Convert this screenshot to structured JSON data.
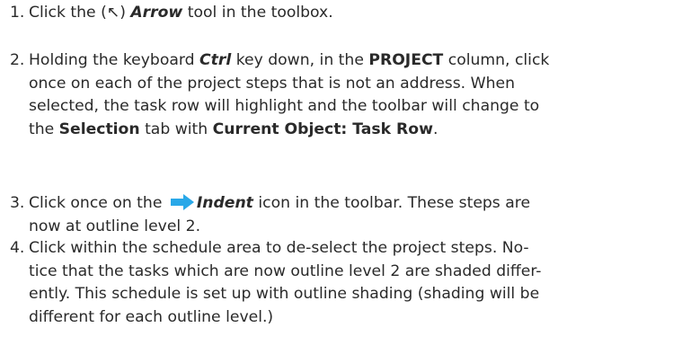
{
  "steps": [
    {
      "number": "1.",
      "lines": [
        [
          "Click  the (",
          "↖",
          ") ",
          "Arrow",
          " tool in the toolbox."
        ]
      ]
    },
    {
      "number": "2.",
      "lines": [
        [
          "Holding the keyboard ",
          "Ctrl",
          " key down, in the ",
          "PROJECT",
          " column, click"
        ],
        [
          "once on each of the project steps that is not an address.  When"
        ],
        [
          "selected, the task row will highlight and the toolbar will change to"
        ],
        [
          "the ",
          "Selection",
          " tab with ",
          "Current Object: Task Row",
          "."
        ]
      ]
    },
    {
      "number": "3.",
      "lines": [
        [
          "Click once on the ",
          "Indent",
          " icon in the toolbar. These steps are"
        ],
        [
          "now at outline level 2."
        ]
      ]
    },
    {
      "number": "4.",
      "lines": [
        [
          "Click within the schedule area to de-select the project steps.  No-"
        ],
        [
          "tice that the tasks which are now outline level 2 are shaded differ-"
        ],
        [
          "ently.  This schedule is set up with outline shading  (shading will be"
        ],
        [
          "different for each outline level.)"
        ]
      ]
    }
  ],
  "icons": {
    "arrow_tool": "arrow-tool-icon",
    "indent": "indent-arrow-icon"
  },
  "colors": {
    "text": "#2a2a2a",
    "indent_icon": "#29a8e8"
  }
}
